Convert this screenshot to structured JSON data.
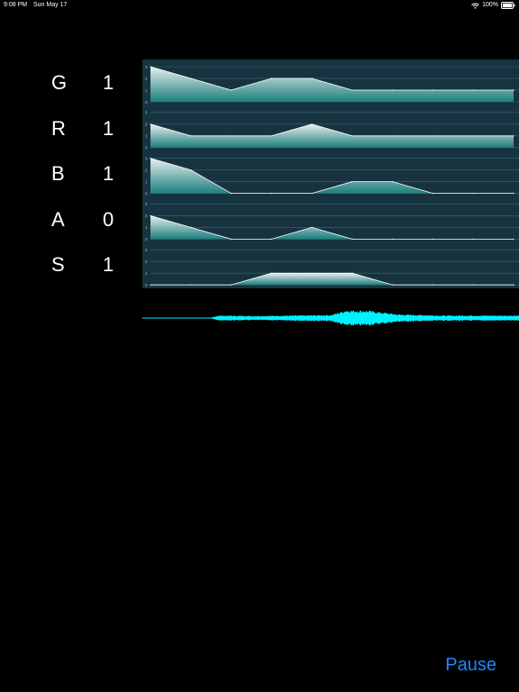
{
  "status_bar": {
    "time": "9:08 PM",
    "date": "Sun May 17",
    "battery": "100%",
    "icons": [
      "wifi-icon",
      "battery-icon"
    ]
  },
  "channels": [
    {
      "label": "G",
      "value": "1"
    },
    {
      "label": "R",
      "value": "1"
    },
    {
      "label": "B",
      "value": "1"
    },
    {
      "label": "A",
      "value": "0"
    },
    {
      "label": "S",
      "value": "1"
    }
  ],
  "chart_data": {
    "type": "area",
    "panel_count": 5,
    "tick_labels": [
      "0",
      "1",
      "2",
      "3"
    ],
    "ylim": [
      0,
      3
    ],
    "x": [
      0,
      1,
      2,
      3,
      4,
      5,
      6,
      7,
      8,
      9
    ],
    "series": [
      {
        "values": [
          3,
          2,
          1,
          2,
          2,
          1,
          1,
          1,
          1,
          1
        ]
      },
      {
        "values": [
          2,
          1,
          1,
          1,
          2,
          1,
          1,
          1,
          1,
          1
        ]
      },
      {
        "values": [
          3,
          2,
          0,
          0,
          0,
          1,
          1,
          0,
          0,
          0
        ]
      },
      {
        "values": [
          2,
          1,
          0,
          0,
          1,
          0,
          0,
          0,
          0,
          0
        ]
      },
      {
        "values": [
          0,
          0,
          0,
          1,
          1,
          1,
          0,
          0,
          0,
          0
        ]
      }
    ],
    "colors": {
      "background": "#17333f",
      "grid": "#3d6a78",
      "fill_top": "#e8eef0",
      "fill_bottom": "#1c7f7c",
      "line": "#ffffff"
    }
  },
  "waveform": {
    "color": "#00f0ff",
    "envelope": [
      [
        0.0,
        0.01
      ],
      [
        0.18,
        0.01
      ],
      [
        0.2,
        0.25
      ],
      [
        0.3,
        0.2
      ],
      [
        0.5,
        0.3
      ],
      [
        0.54,
        0.75
      ],
      [
        0.6,
        0.7
      ],
      [
        0.68,
        0.35
      ],
      [
        0.8,
        0.25
      ],
      [
        1.0,
        0.25
      ]
    ]
  },
  "controls": {
    "pause_label": "Pause"
  }
}
